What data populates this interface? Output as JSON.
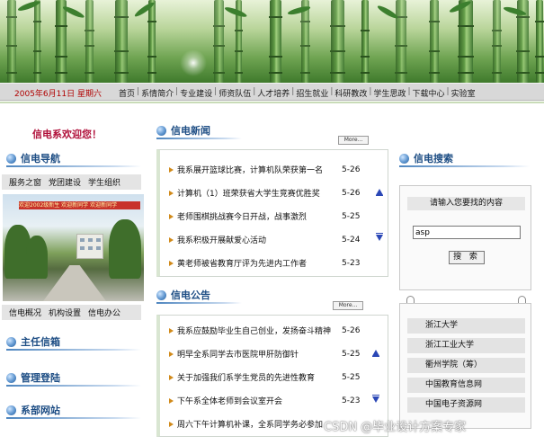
{
  "header": {
    "date": "2005年6月11日  星期六",
    "menu": [
      "首页",
      "系情简介",
      "专业建设",
      "师资队伍",
      "人才培养",
      "招生就业",
      "科研教改",
      "学生思政",
      "下载中心",
      "实验室"
    ],
    "separator": "|"
  },
  "welcome": "信电系欢迎您！",
  "left": {
    "nav_title": "信电导航",
    "nav_row1": [
      "服务之窗",
      "党团建设",
      "学生组织"
    ],
    "photo_banner_text": "欢迎2002级新生  欢迎新同学  欢迎新同学",
    "nav_row2": [
      "信电概况",
      "机构设置",
      "信电办公"
    ],
    "section_titles": [
      "主任信箱",
      "管理登陆",
      "系部网站"
    ]
  },
  "news": {
    "title": "信电新闻",
    "more_label": "More...",
    "items": [
      {
        "text": "我系展开篮球比赛，计算机队荣获第一名",
        "date": "5-26"
      },
      {
        "text": "计算机（1）班荣获省大学生竞赛优胜奖",
        "date": "5-26"
      },
      {
        "text": "老师围棋挑战赛今日开战，战事激烈",
        "date": "5-25"
      },
      {
        "text": "我系积极开展献爱心活动",
        "date": "5-24"
      },
      {
        "text": "黄老师被省教育厅评为先进内工作者",
        "date": "5-23"
      }
    ]
  },
  "notice": {
    "title": "信电公告",
    "more_label": "More...",
    "items": [
      {
        "text": "我系应鼓励毕业生自己创业，发扬奋斗精神",
        "date": "5-26"
      },
      {
        "text": "明早全系同学去市医院甲肝防御针",
        "date": "5-25"
      },
      {
        "text": "关于加强我们系学生党员的先进性教育",
        "date": "5-25"
      },
      {
        "text": "下午系全体老师到会议室开会",
        "date": "5-23"
      },
      {
        "text": "周六下午计算机补课，全系同学务必参加",
        "date": ""
      }
    ]
  },
  "search": {
    "title": "信电搜索",
    "prompt": "请输入您要找的内容",
    "input_value": "asp",
    "button_label": "搜 索"
  },
  "links": [
    "浙江大学",
    "浙江工业大学",
    "衢州学院（筹）",
    "中国教育信息网",
    "中国电子资源网"
  ],
  "watermark": "CSDN @毕业设计方案专家",
  "colors": {
    "date_red": "#b00000",
    "welcome_red": "#b0103a",
    "section_blue": "#1d4d84",
    "arrow_orange": "#d18a1a",
    "scroll_blue": "#2a47b6"
  }
}
